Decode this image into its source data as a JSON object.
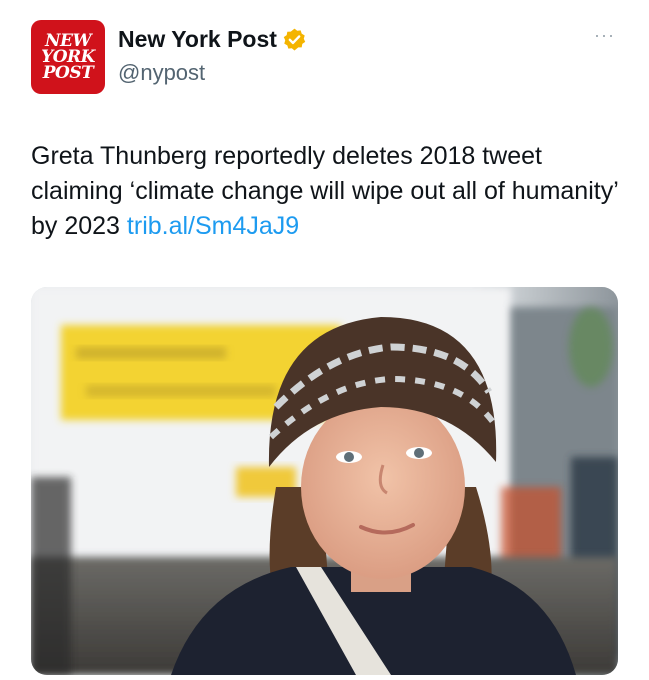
{
  "account": {
    "avatar_lines": [
      "NEW",
      "YORK",
      "POST"
    ],
    "display_name": "New York Post",
    "handle": "@nypost",
    "verified_icon": "verified-badge-icon",
    "verified_color": "#f4b400"
  },
  "menu": {
    "more_label": "···"
  },
  "tweet": {
    "text": "Greta Thunberg reportedly deletes 2018 tweet claiming ‘climate change will wipe out all of humanity’ by 2023 ",
    "link": "trib.al/Sm4JaJ9"
  },
  "media": {
    "alt": "photo"
  },
  "colors": {
    "brand_red": "#d0121b",
    "link_blue": "#1d9bf0",
    "handle_gray": "#536471"
  }
}
